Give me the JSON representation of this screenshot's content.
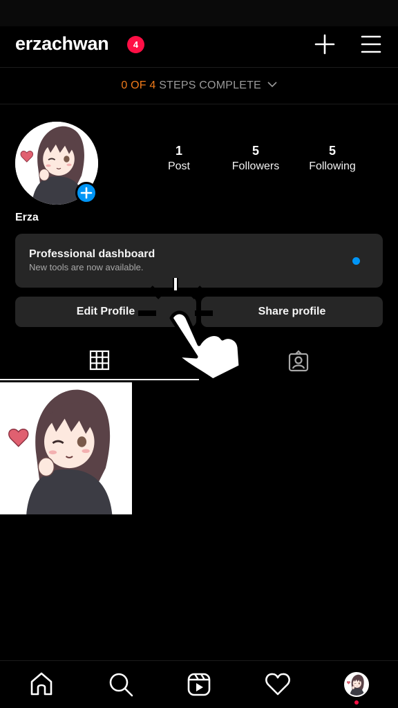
{
  "header": {
    "username": "erzachwan",
    "notification_count": "4",
    "icons": {
      "create": "plus-icon",
      "menu": "hamburger-menu-icon"
    }
  },
  "steps": {
    "progress_text": "0 OF 4",
    "rest_text": "STEPS COMPLETE",
    "completed": 0,
    "total": 4
  },
  "profile": {
    "display_name": "Erza",
    "avatar": "anime-girl-avatar",
    "stats": [
      {
        "value": "1",
        "label": "Post"
      },
      {
        "value": "5",
        "label": "Followers"
      },
      {
        "value": "5",
        "label": "Following"
      }
    ]
  },
  "dashboard": {
    "title": "Professional dashboard",
    "subtitle": "New tools are now available."
  },
  "actions": {
    "edit_label": "Edit Profile",
    "share_label": "Share profile"
  },
  "tabs": [
    {
      "name": "posts-grid",
      "icon": "grid-icon",
      "active": true
    },
    {
      "name": "tagged",
      "icon": "tagged-person-icon",
      "active": false
    }
  ],
  "posts": [
    {
      "image": "anime-girl-finger-heart"
    }
  ],
  "bottom_nav": [
    {
      "name": "home",
      "icon": "home-icon"
    },
    {
      "name": "search",
      "icon": "search-icon"
    },
    {
      "name": "reels",
      "icon": "reels-icon"
    },
    {
      "name": "activity",
      "icon": "heart-icon"
    },
    {
      "name": "profile",
      "icon": "profile-avatar-icon"
    }
  ],
  "colors": {
    "accent_blue": "#0095f6",
    "badge_red": "#ff0f45",
    "steps_orange": "#f07a1a",
    "card_bg": "#262626"
  }
}
